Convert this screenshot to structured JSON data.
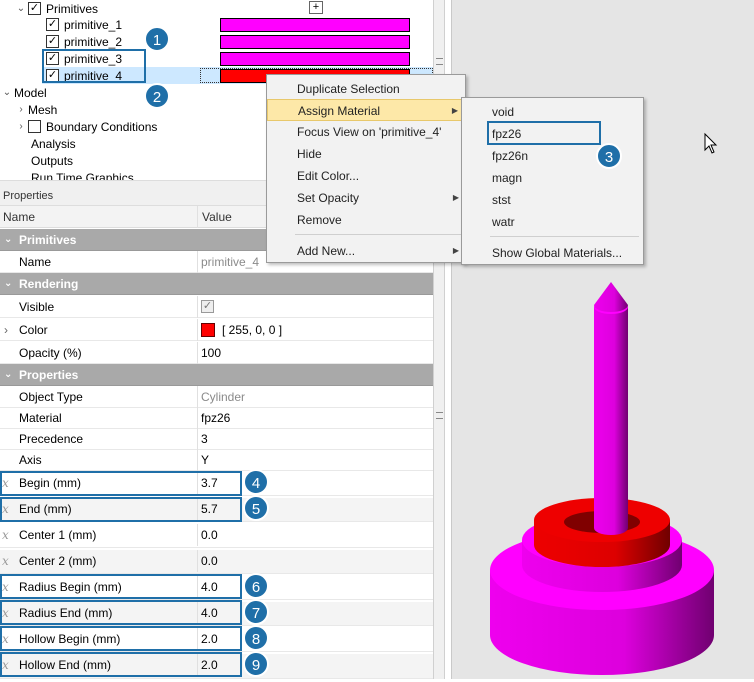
{
  "tree": {
    "primitives_label": "Primitives",
    "add_button": "+",
    "items": [
      {
        "label": "primitive_1",
        "color": "#ff00ff"
      },
      {
        "label": "primitive_2",
        "color": "#ff00ff"
      },
      {
        "label": "primitive_3",
        "color": "#ff00ff"
      },
      {
        "label": "primitive_4",
        "color": "#ff0000"
      }
    ],
    "model_label": "Model",
    "mesh_label": "Mesh",
    "boundary_label": "Boundary Conditions",
    "analysis_label": "Analysis",
    "outputs_label": "Outputs",
    "runtime_label": "Run Time Graphics"
  },
  "properties": {
    "panel_title": "Properties",
    "col_name": "Name",
    "col_value": "Value",
    "cat_primitives": "Primitives",
    "name_label": "Name",
    "name_value": "primitive_4",
    "cat_rendering": "Rendering",
    "visible_label": "Visible",
    "color_label": "Color",
    "color_value": "[ 255, 0, 0 ]",
    "color_swatch": "#ff0000",
    "opacity_label": "Opacity (%)",
    "opacity_value": "100",
    "cat_properties": "Properties",
    "objtype_label": "Object Type",
    "objtype_value": "Cylinder",
    "material_label": "Material",
    "material_value": "fpz26",
    "precedence_label": "Precedence",
    "precedence_value": "3",
    "axis_label": "Axis",
    "axis_value": "Y",
    "begin_label": "Begin (mm)",
    "begin_value": "3.7",
    "end_label": "End (mm)",
    "end_value": "5.7",
    "center1_label": "Center 1 (mm)",
    "center1_value": "0.0",
    "center2_label": "Center 2 (mm)",
    "center2_value": "0.0",
    "rbegin_label": "Radius Begin (mm)",
    "rbegin_value": "4.0",
    "rend_label": "Radius End (mm)",
    "rend_value": "4.0",
    "hbegin_label": "Hollow Begin (mm)",
    "hbegin_value": "2.0",
    "hend_label": "Hollow End (mm)",
    "hend_value": "2.0",
    "fx_symbol": "x"
  },
  "context_menu": {
    "duplicate": "Duplicate Selection",
    "assign_material": "Assign Material",
    "focus_view": "Focus View on 'primitive_4'",
    "hide": "Hide",
    "edit_color": "Edit Color...",
    "set_opacity": "Set Opacity",
    "remove": "Remove",
    "add_new": "Add New...",
    "arrow": "▶"
  },
  "material_menu": {
    "items": [
      "void",
      "fpz26",
      "fpz26n",
      "magn",
      "stst",
      "watr"
    ],
    "global": "Show Global Materials..."
  },
  "badges": [
    "1",
    "2",
    "3",
    "4",
    "5",
    "6",
    "7",
    "8",
    "9"
  ],
  "colors": {
    "accent": "#1f6fa8",
    "magenta": "#ff00ff",
    "red": "#ff0000",
    "category_bg": "#a9a9a9",
    "view_bg": "#e5e5e5"
  }
}
